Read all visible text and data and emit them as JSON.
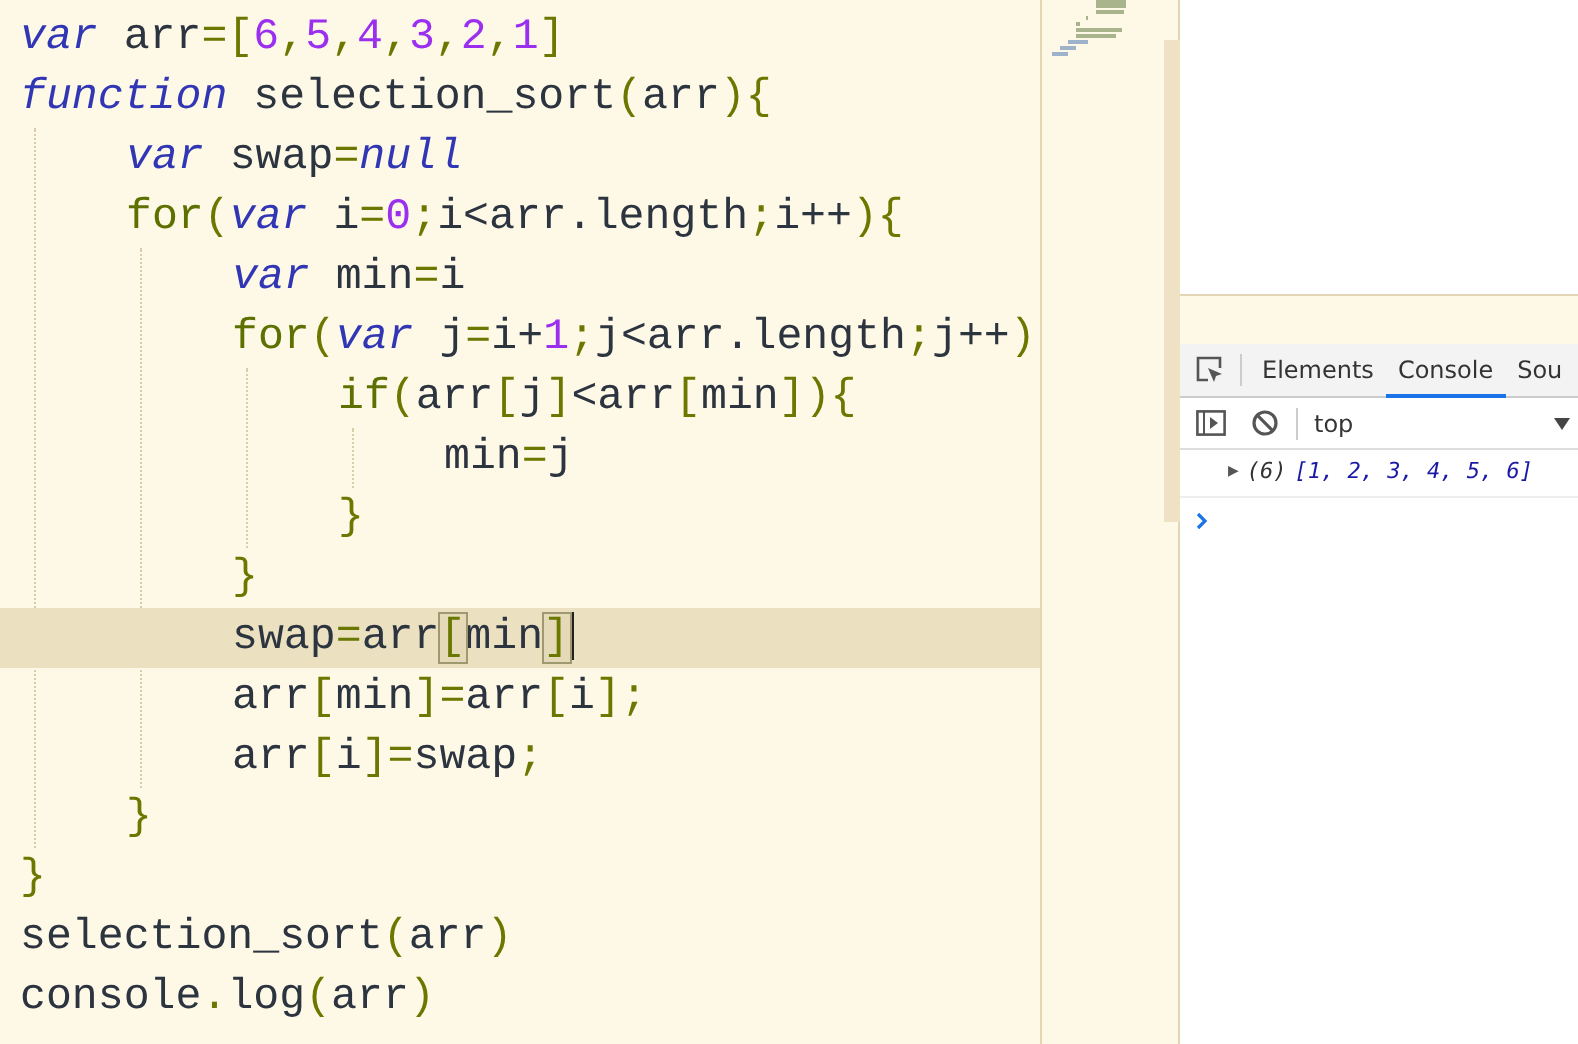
{
  "editor": {
    "lines": [
      {
        "tokens": [
          {
            "text": "var",
            "kind": "keyword"
          },
          {
            "text": " arr",
            "kind": "ident"
          },
          {
            "text": "=[",
            "kind": "punct"
          },
          {
            "text": "6",
            "kind": "number"
          },
          {
            "text": ",",
            "kind": "punct"
          },
          {
            "text": "5",
            "kind": "number"
          },
          {
            "text": ",",
            "kind": "punct"
          },
          {
            "text": "4",
            "kind": "number"
          },
          {
            "text": ",",
            "kind": "punct"
          },
          {
            "text": "3",
            "kind": "number"
          },
          {
            "text": ",",
            "kind": "punct"
          },
          {
            "text": "2",
            "kind": "number"
          },
          {
            "text": ",",
            "kind": "punct"
          },
          {
            "text": "1",
            "kind": "number"
          },
          {
            "text": "]",
            "kind": "punct"
          }
        ]
      },
      {
        "tokens": [
          {
            "text": "function",
            "kind": "keyword"
          },
          {
            "text": " selection_sort",
            "kind": "ident"
          },
          {
            "text": "(",
            "kind": "punct"
          },
          {
            "text": "arr",
            "kind": "ident"
          },
          {
            "text": "){",
            "kind": "punct"
          }
        ],
        "children": [
          {
            "tokens": [
              {
                "text": "var",
                "kind": "keyword"
              },
              {
                "text": " swap",
                "kind": "ident"
              },
              {
                "text": "=",
                "kind": "punct"
              },
              {
                "text": "null",
                "kind": "keyword"
              }
            ]
          },
          {
            "tokens": [
              {
                "text": "for",
                "kind": "control"
              },
              {
                "text": "(",
                "kind": "punct"
              },
              {
                "text": "var",
                "kind": "keyword"
              },
              {
                "text": " i",
                "kind": "ident"
              },
              {
                "text": "=",
                "kind": "punct"
              },
              {
                "text": "0",
                "kind": "number"
              },
              {
                "text": ";",
                "kind": "punct"
              },
              {
                "text": "i<arr.length",
                "kind": "ident"
              },
              {
                "text": ";",
                "kind": "punct"
              },
              {
                "text": "i++",
                "kind": "ident"
              },
              {
                "text": "){",
                "kind": "punct"
              }
            ],
            "children": [
              {
                "tokens": [
                  {
                    "text": "var",
                    "kind": "keyword"
                  },
                  {
                    "text": " min",
                    "kind": "ident"
                  },
                  {
                    "text": "=",
                    "kind": "punct"
                  },
                  {
                    "text": "i",
                    "kind": "ident"
                  }
                ]
              },
              {
                "tokens": [
                  {
                    "text": "for",
                    "kind": "control"
                  },
                  {
                    "text": "(",
                    "kind": "punct"
                  },
                  {
                    "text": "var",
                    "kind": "keyword"
                  },
                  {
                    "text": " j",
                    "kind": "ident"
                  },
                  {
                    "text": "=",
                    "kind": "punct"
                  },
                  {
                    "text": "i+",
                    "kind": "ident"
                  },
                  {
                    "text": "1",
                    "kind": "number"
                  },
                  {
                    "text": ";",
                    "kind": "punct"
                  },
                  {
                    "text": "j<arr.length",
                    "kind": "ident"
                  },
                  {
                    "text": ";",
                    "kind": "punct"
                  },
                  {
                    "text": "j++",
                    "kind": "ident"
                  },
                  {
                    "text": ")",
                    "kind": "punct"
                  }
                ],
                "children": [
                  {
                    "tokens": [
                      {
                        "text": "if",
                        "kind": "control"
                      },
                      {
                        "text": "(",
                        "kind": "punct"
                      },
                      {
                        "text": "arr",
                        "kind": "ident"
                      },
                      {
                        "text": "[",
                        "kind": "punct"
                      },
                      {
                        "text": "j",
                        "kind": "ident"
                      },
                      {
                        "text": "]",
                        "kind": "punct"
                      },
                      {
                        "text": "<arr",
                        "kind": "ident"
                      },
                      {
                        "text": "[",
                        "kind": "punct"
                      },
                      {
                        "text": "min",
                        "kind": "ident"
                      },
                      {
                        "text": "]){",
                        "kind": "punct"
                      }
                    ],
                    "children": [
                      {
                        "tokens": [
                          {
                            "text": "min",
                            "kind": "ident"
                          },
                          {
                            "text": "=",
                            "kind": "punct"
                          },
                          {
                            "text": "j",
                            "kind": "ident"
                          }
                        ]
                      }
                    ]
                  },
                  {
                    "tokens": [
                      {
                        "text": "}",
                        "kind": "punct"
                      }
                    ]
                  }
                ]
              },
              {
                "tokens": [
                  {
                    "text": "}",
                    "kind": "punct"
                  }
                ]
              },
              {
                "tokens": [
                  {
                    "text": "swap",
                    "kind": "ident"
                  },
                  {
                    "text": "=",
                    "kind": "punct"
                  },
                  {
                    "text": "arr",
                    "kind": "ident"
                  },
                  {
                    "text": "[",
                    "kind": "punct",
                    "matched": true
                  },
                  {
                    "text": "min",
                    "kind": "ident"
                  },
                  {
                    "text": "]",
                    "kind": "punct",
                    "matched": true
                  }
                ],
                "current": true
              },
              {
                "tokens": [
                  {
                    "text": "arr",
                    "kind": "ident"
                  },
                  {
                    "text": "[",
                    "kind": "punct"
                  },
                  {
                    "text": "min",
                    "kind": "ident"
                  },
                  {
                    "text": "]=",
                    "kind": "punct"
                  },
                  {
                    "text": "arr",
                    "kind": "ident"
                  },
                  {
                    "text": "[",
                    "kind": "punct"
                  },
                  {
                    "text": "i",
                    "kind": "ident"
                  },
                  {
                    "text": "];",
                    "kind": "punct"
                  }
                ]
              },
              {
                "tokens": [
                  {
                    "text": "arr",
                    "kind": "ident"
                  },
                  {
                    "text": "[",
                    "kind": "punct"
                  },
                  {
                    "text": "i",
                    "kind": "ident"
                  },
                  {
                    "text": "]=",
                    "kind": "punct"
                  },
                  {
                    "text": "swap",
                    "kind": "ident"
                  },
                  {
                    "text": ";",
                    "kind": "punct"
                  }
                ]
              }
            ]
          },
          {
            "tokens": [
              {
                "text": "}",
                "kind": "punct"
              }
            ]
          }
        ]
      },
      {
        "tokens": [
          {
            "text": "}",
            "kind": "punct"
          }
        ]
      },
      {
        "tokens": [
          {
            "text": "selection_sort",
            "kind": "ident"
          },
          {
            "text": "(",
            "kind": "punct"
          },
          {
            "text": "arr",
            "kind": "ident"
          },
          {
            "text": ")",
            "kind": "punct"
          }
        ]
      },
      {
        "tokens": [
          {
            "text": "console",
            "kind": "ident"
          },
          {
            "text": ".",
            "kind": "punct"
          },
          {
            "text": "log",
            "kind": "ident"
          },
          {
            "text": "(",
            "kind": "punct"
          },
          {
            "text": "arr",
            "kind": "ident"
          },
          {
            "text": ")",
            "kind": "punct"
          }
        ]
      }
    ]
  },
  "devtools": {
    "tabs": [
      {
        "label": "Elements",
        "selected": false
      },
      {
        "label": "Console",
        "selected": true
      },
      {
        "label": "Sou",
        "selected": false
      }
    ],
    "context": "top",
    "messages": [
      {
        "expander": "▶",
        "count": "(6)",
        "value": "[1, 2, 3, 4, 5, 6]",
        "expanded": false
      }
    ]
  }
}
